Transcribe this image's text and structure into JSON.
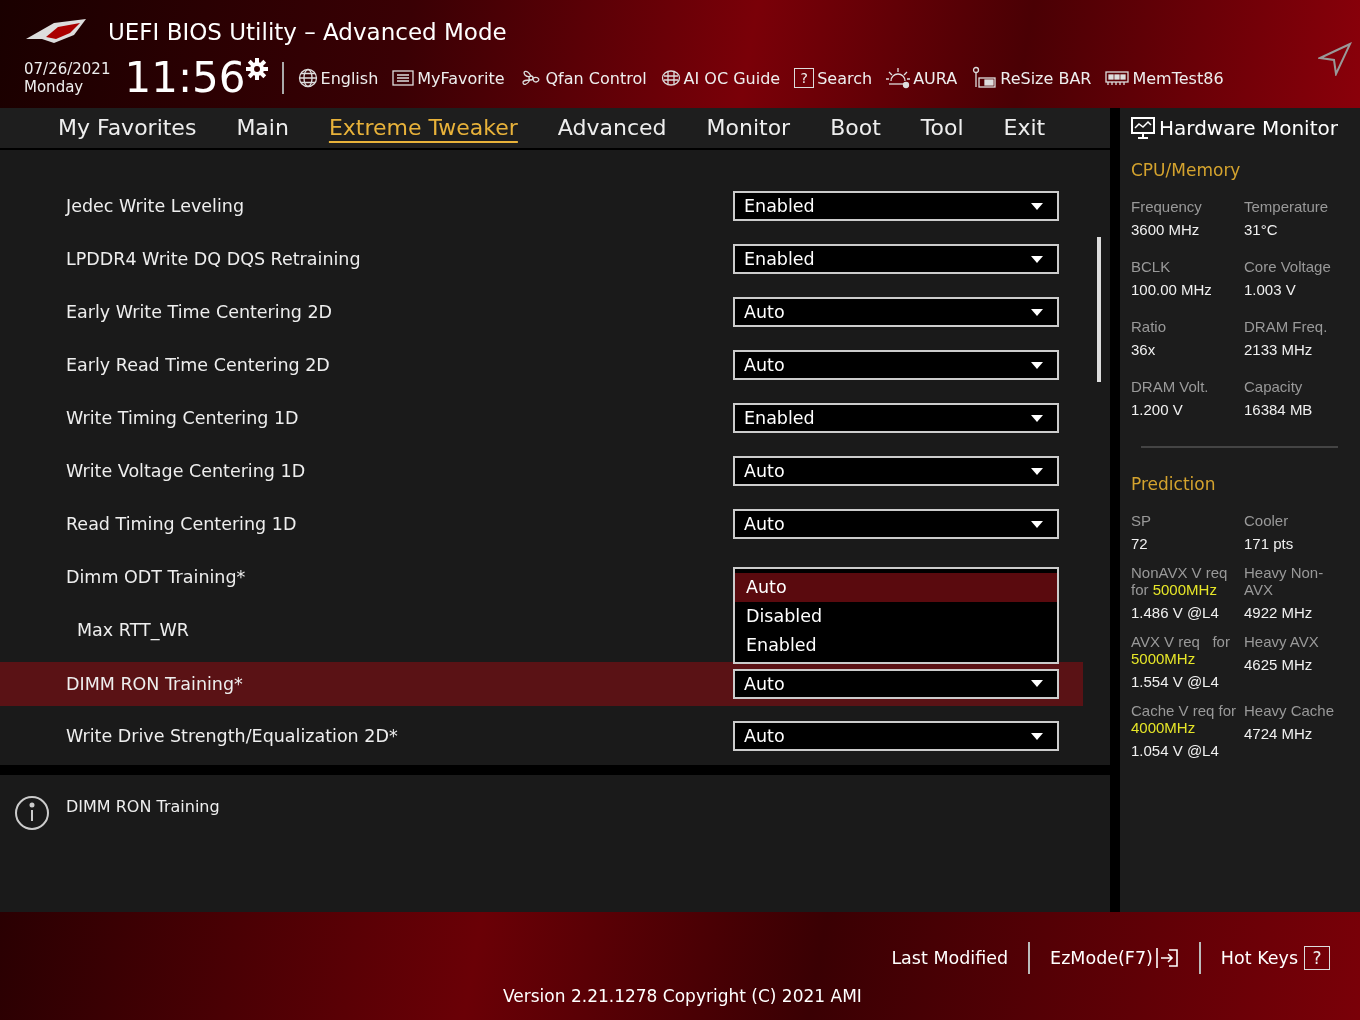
{
  "window": {
    "title": "UEFI BIOS Utility – Advanced Mode"
  },
  "clock": {
    "date": "07/26/2021",
    "day": "Monday",
    "time": "11:56"
  },
  "toolbar": [
    {
      "kind": "globe",
      "label": "English"
    },
    {
      "kind": "list",
      "label": "MyFavorite"
    },
    {
      "kind": "fan",
      "label": "Qfan Control"
    },
    {
      "kind": "chip",
      "label": "AI OC Guide"
    },
    {
      "kind": "glyph",
      "glyph": "?",
      "label": "Search"
    },
    {
      "kind": "sun",
      "label": "AURA"
    },
    {
      "kind": "card",
      "label": "ReSize BAR"
    },
    {
      "kind": "memory",
      "label": "MemTest86"
    }
  ],
  "tabs": [
    {
      "label": "My Favorites",
      "selected": false
    },
    {
      "label": "Main",
      "selected": false
    },
    {
      "label": "Extreme Tweaker",
      "selected": true
    },
    {
      "label": "Advanced",
      "selected": false
    },
    {
      "label": "Monitor",
      "selected": false
    },
    {
      "label": "Boot",
      "selected": false
    },
    {
      "label": "Tool",
      "selected": false
    },
    {
      "label": "Exit",
      "selected": false
    }
  ],
  "settings": [
    {
      "label": "Jedec Write Leveling",
      "value": "Enabled",
      "selected": false
    },
    {
      "label": "LPDDR4 Write DQ DQS Retraining",
      "value": "Enabled",
      "selected": false
    },
    {
      "label": "Early Write Time Centering 2D",
      "value": "Auto",
      "selected": false
    },
    {
      "label": "Early Read Time Centering 2D",
      "value": "Auto",
      "selected": false
    },
    {
      "label": "Write Timing Centering 1D",
      "value": "Enabled",
      "selected": false
    },
    {
      "label": "Write Voltage Centering 1D",
      "value": "Auto",
      "selected": false
    },
    {
      "label": "Read Timing Centering 1D",
      "value": "Auto",
      "selected": false
    },
    {
      "label": "Dimm ODT Training*",
      "selected": false,
      "children": [
        {
          "label": "Max RTT_WR",
          "selected": false
        }
      ]
    },
    {
      "label": "DIMM RON Training*",
      "value": "Auto",
      "selected": true
    },
    {
      "label": "Write Drive Strength/Equalization 2D*",
      "value": "Auto",
      "selected": false
    }
  ],
  "dropdown_list": {
    "options": [
      {
        "label": "Auto",
        "selected": true
      },
      {
        "label": "Disabled",
        "selected": false
      },
      {
        "label": "Enabled",
        "selected": false
      }
    ]
  },
  "help": {
    "text": "DIMM RON Training"
  },
  "hardware_monitor": {
    "title": "Hardware Monitor",
    "cpu_memory": {
      "title": "CPU/Memory",
      "items": [
        {
          "label": "Frequency",
          "value": "3600 MHz"
        },
        {
          "label": "Temperature",
          "value": "31°C"
        },
        {
          "label": "BCLK",
          "value": "100.00 MHz"
        },
        {
          "label": "Core Voltage",
          "value": "1.003 V"
        },
        {
          "label": "Ratio",
          "value": "36x"
        },
        {
          "label": "DRAM Freq.",
          "value": "2133 MHz"
        },
        {
          "label": "DRAM Volt.",
          "value": "1.200 V"
        },
        {
          "label": "Capacity",
          "value": "16384 MB"
        }
      ]
    },
    "prediction": {
      "title": "Prediction",
      "items": [
        {
          "label": "SP",
          "value": "72"
        },
        {
          "label": "Cooler",
          "value": "171 pts"
        },
        {
          "label": "NonAVX V req for",
          "highlight": "5000MHz",
          "value": "1.486 V @L4"
        },
        {
          "label": "Heavy Non-AVX",
          "value": "4922 MHz"
        },
        {
          "label": "AVX V req   for",
          "highlight": "5000MHz",
          "value": "1.554 V @L4"
        },
        {
          "label": "Heavy AVX",
          "value": "4625 MHz"
        },
        {
          "label": "Cache V req for",
          "highlight": "4000MHz",
          "value": "1.054 V @L4"
        },
        {
          "label": "Heavy Cache",
          "value": "4724 MHz"
        }
      ]
    }
  },
  "footer": {
    "last_modified": "Last Modified",
    "ezmode": "EzMode(F7)",
    "hot_keys": "Hot Keys",
    "hot_keys_glyph": "?",
    "version": "Version 2.21.1278 Copyright (C) 2021 AMI"
  }
}
